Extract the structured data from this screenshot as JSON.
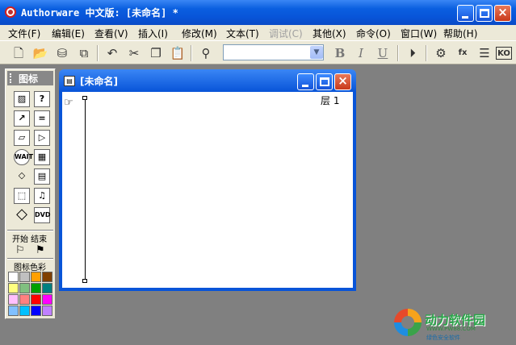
{
  "window": {
    "title": "Authorware 中文版: [未命名] *",
    "buttons": {
      "minimize": "minimize",
      "maximize": "maximize",
      "close": "×"
    }
  },
  "menu": [
    {
      "label": "文件(F)",
      "enabled": true
    },
    {
      "label": "编辑(E)",
      "enabled": true
    },
    {
      "label": "查看(V)",
      "enabled": true
    },
    {
      "label": "插入(I)",
      "enabled": true
    },
    {
      "label": "修改(M)",
      "enabled": true
    },
    {
      "label": "文本(T)",
      "enabled": true
    },
    {
      "label": "调试(C)",
      "enabled": false
    },
    {
      "label": "其他(X)",
      "enabled": true
    },
    {
      "label": "命令(O)",
      "enabled": true
    },
    {
      "label": "窗口(W)",
      "enabled": true
    },
    {
      "label": "帮助(H)",
      "enabled": true
    }
  ],
  "toolbar": {
    "icons": {
      "new": "🗋",
      "open": "📂",
      "save_all": "⛁",
      "import": "⧉",
      "undo": "↶",
      "cut": "✂",
      "copy": "❐",
      "paste": "📋",
      "find": "⚲",
      "bold": "B",
      "italic": "I",
      "underline": "U",
      "run": "⏵",
      "control_panel": "⚙",
      "functions": "fx",
      "variables": "☰",
      "knowledge_objects": "KO"
    },
    "font_select_value": "",
    "font_select_arrow": "▼"
  },
  "palette": {
    "title": "图标",
    "icons": {
      "display": "▨",
      "interaction": "?",
      "calculation": "=",
      "erase": "▱",
      "navigate": "▷",
      "wait": "WAIT",
      "framework": "▦",
      "decision": "◇",
      "map": "⬚",
      "movie": "▤",
      "sound": "♫",
      "video": "DVD",
      "animation": "↗",
      "ko": "KO"
    },
    "start_stop_label": "开始 结束",
    "start_flag": "⚐",
    "stop_flag": "⚑",
    "color_label": "图标色彩",
    "colors": [
      "#ffffff",
      "#c0c0c0",
      "#ffa000",
      "#804000",
      "#ffff80",
      "#80c080",
      "#00a000",
      "#008080",
      "#ffc0ff",
      "#ff8080",
      "#ff0000",
      "#ff00ff",
      "#80c0ff",
      "#00c0ff",
      "#0000ff",
      "#c080ff"
    ]
  },
  "design_window": {
    "title": "[未命名]",
    "icon": "▤",
    "layer_label": "层 1",
    "pointer": "☞"
  },
  "watermark": {
    "brand": "动力软件园",
    "url": "WWW.PW88.COM",
    "slogan": "绿色安全软件"
  }
}
